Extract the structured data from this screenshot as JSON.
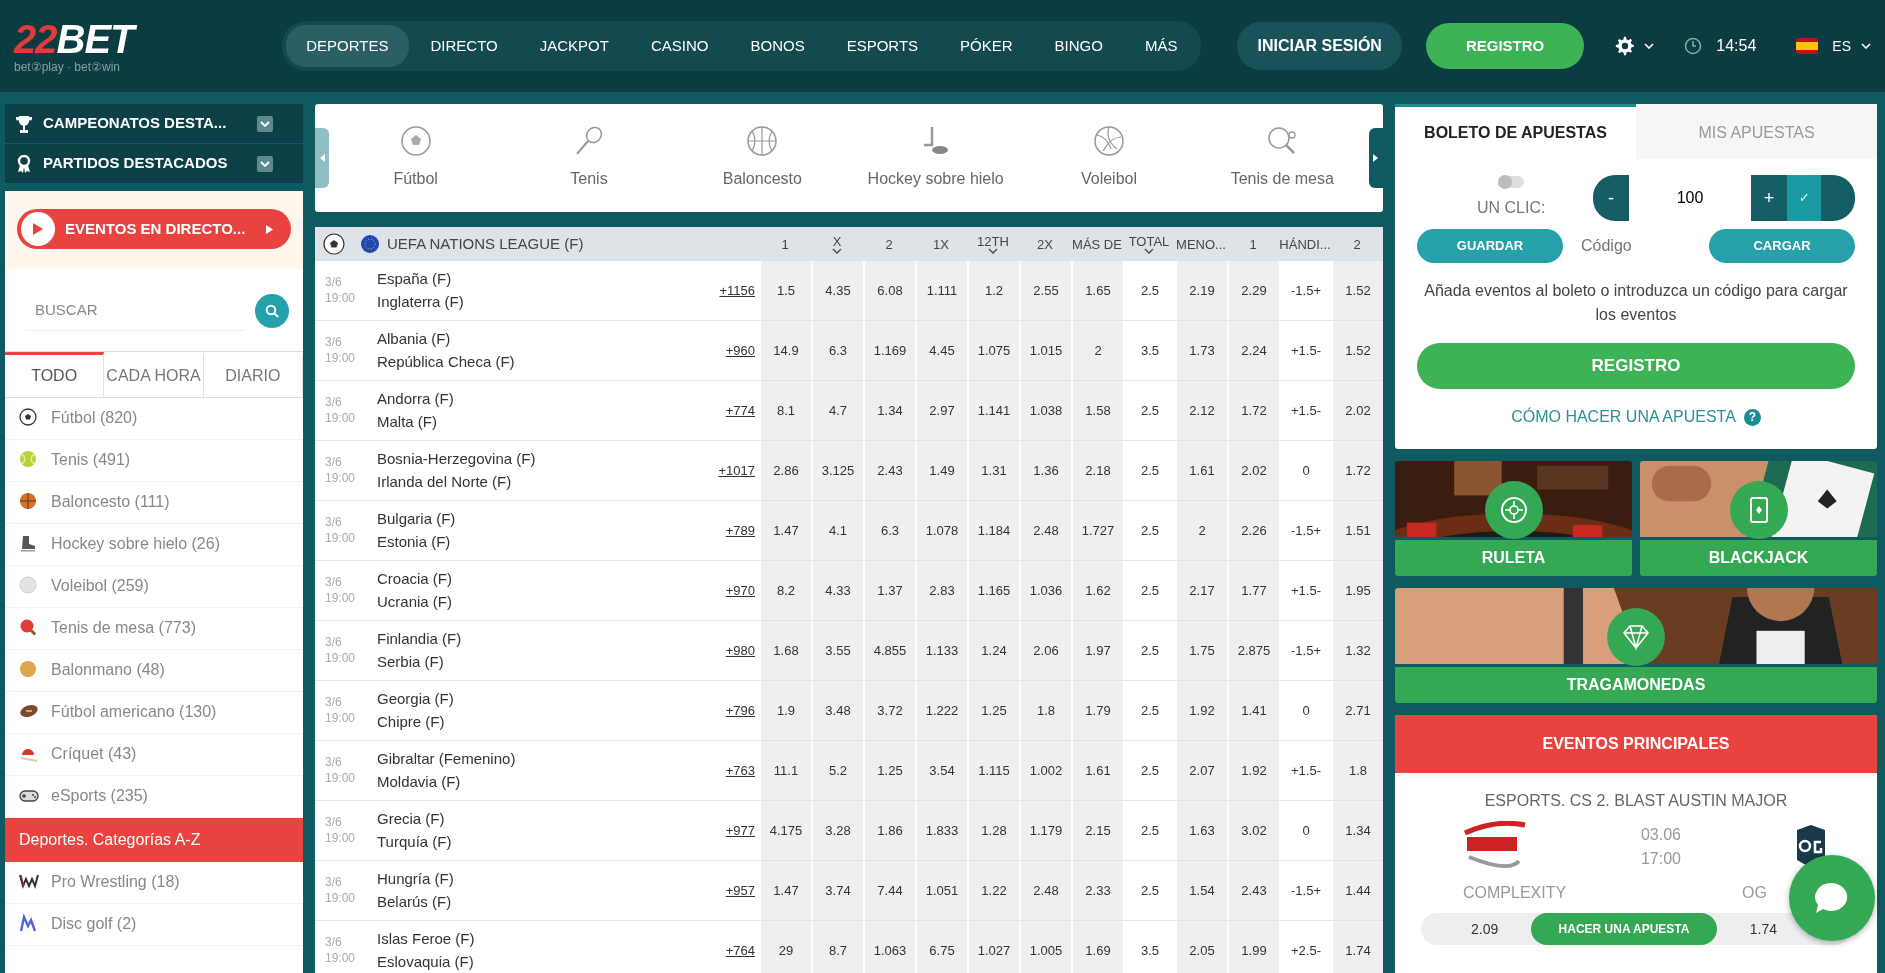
{
  "header": {
    "logo": {
      "mark": "22",
      "name": "BET",
      "tagline": "bet②play · bet②win"
    },
    "nav": [
      {
        "label": "DEPORTES",
        "selected": true
      },
      {
        "label": "DIRECTO",
        "selected": false
      },
      {
        "label": "JACKPOT",
        "selected": false
      },
      {
        "label": "CASINO",
        "selected": false
      },
      {
        "label": "BONOS",
        "selected": false
      },
      {
        "label": "ESPORTS",
        "selected": false
      },
      {
        "label": "PÓKER",
        "selected": false
      },
      {
        "label": "BINGO",
        "selected": false
      },
      {
        "label": "MÁS",
        "selected": false
      }
    ],
    "login": "INICIAR SESIÓN",
    "register": "REGISTRO",
    "time": "14:54",
    "language": "ES"
  },
  "sidebar": {
    "menus": [
      {
        "label": "CAMPEONATOS DESTA..."
      },
      {
        "label": "PARTIDOS DESTACADOS"
      }
    ],
    "live_button": "EVENTOS EN DIRECTO...",
    "search": {
      "placeholder": "BUSCAR"
    },
    "tabs": [
      {
        "label": "TODO",
        "selected": true
      },
      {
        "label": "CADA HORA",
        "selected": false
      },
      {
        "label": "DIARIO",
        "selected": false
      }
    ],
    "sports": [
      {
        "name": "Fútbol (820)"
      },
      {
        "name": "Tenis (491)"
      },
      {
        "name": "Baloncesto (111)"
      },
      {
        "name": "Hockey sobre hielo (26)"
      },
      {
        "name": "Voleibol (259)"
      },
      {
        "name": "Tenis de mesa (773)"
      },
      {
        "name": "Balonmano (48)"
      },
      {
        "name": "Fútbol americano (130)"
      },
      {
        "name": "Críquet (43)"
      },
      {
        "name": "eSports (235)"
      }
    ],
    "section": "Deportes. Categorías A-Z",
    "categories": [
      {
        "name": "Pro Wrestling (18)"
      },
      {
        "name": "Disc golf (2)"
      }
    ]
  },
  "sport_strip": {
    "items": [
      {
        "label": "Fútbol"
      },
      {
        "label": "Tenis"
      },
      {
        "label": "Baloncesto"
      },
      {
        "label": "Hockey sobre hielo"
      },
      {
        "label": "Voleibol"
      },
      {
        "label": "Tenis de mesa"
      }
    ]
  },
  "table": {
    "league": "UEFA NATIONS LEAGUE (F)",
    "columns": [
      {
        "label": "1",
        "kind": "odds",
        "dropdown": false
      },
      {
        "label": "X",
        "kind": "odds",
        "dropdown": true
      },
      {
        "label": "2",
        "kind": "odds",
        "dropdown": false
      },
      {
        "label": "1X",
        "kind": "odds",
        "dropdown": false
      },
      {
        "label": "12TH",
        "kind": "odds",
        "dropdown": true
      },
      {
        "label": "2X",
        "kind": "odds",
        "dropdown": false
      },
      {
        "label": "MÁS DE",
        "kind": "odds",
        "dropdown": false
      },
      {
        "label": "TOTAL",
        "kind": "param",
        "dropdown": true
      },
      {
        "label": "MENO...",
        "kind": "odds",
        "dropdown": false
      },
      {
        "label": "1",
        "kind": "odds",
        "dropdown": false
      },
      {
        "label": "HÁNDI...",
        "kind": "param",
        "dropdown": false
      },
      {
        "label": "2",
        "kind": "odds",
        "dropdown": false
      }
    ],
    "rows": [
      {
        "date": "3/6",
        "time": "19:00",
        "home": "España (F)",
        "away": "Inglaterra (F)",
        "more": "+1156",
        "odds": [
          "1.5",
          "4.35",
          "6.08",
          "1.111",
          "1.2",
          "2.55",
          "1.65",
          "2.5",
          "2.19",
          "2.29",
          "-1.5+",
          "1.52"
        ]
      },
      {
        "date": "3/6",
        "time": "19:00",
        "home": "Albania (F)",
        "away": "República Checa (F)",
        "more": "+960",
        "odds": [
          "14.9",
          "6.3",
          "1.169",
          "4.45",
          "1.075",
          "1.015",
          "2",
          "3.5",
          "1.73",
          "2.24",
          "+1.5-",
          "1.52"
        ]
      },
      {
        "date": "3/6",
        "time": "19:00",
        "home": "Andorra (F)",
        "away": "Malta (F)",
        "more": "+774",
        "odds": [
          "8.1",
          "4.7",
          "1.34",
          "2.97",
          "1.141",
          "1.038",
          "1.58",
          "2.5",
          "2.12",
          "1.72",
          "+1.5-",
          "2.02"
        ]
      },
      {
        "date": "3/6",
        "time": "19:00",
        "home": "Bosnia-Herzegovina (F)",
        "away": "Irlanda del Norte (F)",
        "more": "+1017",
        "odds": [
          "2.86",
          "3.125",
          "2.43",
          "1.49",
          "1.31",
          "1.36",
          "2.18",
          "2.5",
          "1.61",
          "2.02",
          "0",
          "1.72"
        ]
      },
      {
        "date": "3/6",
        "time": "19:00",
        "home": "Bulgaria (F)",
        "away": "Estonia (F)",
        "more": "+789",
        "odds": [
          "1.47",
          "4.1",
          "6.3",
          "1.078",
          "1.184",
          "2.48",
          "1.727",
          "2.5",
          "2",
          "2.26",
          "-1.5+",
          "1.51"
        ]
      },
      {
        "date": "3/6",
        "time": "19:00",
        "home": "Croacia (F)",
        "away": "Ucrania (F)",
        "more": "+970",
        "odds": [
          "8.2",
          "4.33",
          "1.37",
          "2.83",
          "1.165",
          "1.036",
          "1.62",
          "2.5",
          "2.17",
          "1.77",
          "+1.5-",
          "1.95"
        ]
      },
      {
        "date": "3/6",
        "time": "19:00",
        "home": "Finlandia (F)",
        "away": "Serbia (F)",
        "more": "+980",
        "odds": [
          "1.68",
          "3.55",
          "4.855",
          "1.133",
          "1.24",
          "2.06",
          "1.97",
          "2.5",
          "1.75",
          "2.875",
          "-1.5+",
          "1.32"
        ]
      },
      {
        "date": "3/6",
        "time": "19:00",
        "home": "Georgia (F)",
        "away": "Chipre (F)",
        "more": "+796",
        "odds": [
          "1.9",
          "3.48",
          "3.72",
          "1.222",
          "1.25",
          "1.8",
          "1.79",
          "2.5",
          "1.92",
          "1.41",
          "0",
          "2.71"
        ]
      },
      {
        "date": "3/6",
        "time": "19:00",
        "home": "Gibraltar (Femenino)",
        "away": "Moldavia (F)",
        "more": "+763",
        "odds": [
          "11.1",
          "5.2",
          "1.25",
          "3.54",
          "1.115",
          "1.002",
          "1.61",
          "2.5",
          "2.07",
          "1.92",
          "+1.5-",
          "1.8"
        ]
      },
      {
        "date": "3/6",
        "time": "19:00",
        "home": "Grecia (F)",
        "away": "Turquía (F)",
        "more": "+977",
        "odds": [
          "4.175",
          "3.28",
          "1.86",
          "1.833",
          "1.28",
          "1.179",
          "2.15",
          "2.5",
          "1.63",
          "3.02",
          "0",
          "1.34"
        ]
      },
      {
        "date": "3/6",
        "time": "19:00",
        "home": "Hungría (F)",
        "away": "Belarús (F)",
        "more": "+957",
        "odds": [
          "1.47",
          "3.74",
          "7.44",
          "1.051",
          "1.22",
          "2.48",
          "2.33",
          "2.5",
          "1.54",
          "2.43",
          "-1.5+",
          "1.44"
        ]
      },
      {
        "date": "3/6",
        "time": "19:00",
        "home": "Islas Feroe (F)",
        "away": "Eslovaquia (F)",
        "more": "+764",
        "odds": [
          "29",
          "8.7",
          "1.063",
          "6.75",
          "1.027",
          "1.005",
          "1.69",
          "3.5",
          "2.05",
          "1.99",
          "+2.5-",
          "1.74"
        ]
      }
    ]
  },
  "betslip": {
    "tabs": [
      {
        "label": "BOLETO DE APUESTAS",
        "selected": true
      },
      {
        "label": "MIS APUESTAS",
        "selected": false
      }
    ],
    "one_click": {
      "label": "UN CLIC:",
      "on": false
    },
    "stake": {
      "minus": "-",
      "value": "100",
      "plus": "+",
      "confirm": "✓"
    },
    "save": "GUARDAR",
    "code": {
      "placeholder": "Código"
    },
    "load": "CARGAR",
    "message": "Añada eventos al boleto o introduzca un código para cargar los eventos",
    "register": "REGISTRO",
    "help": "CÓMO HACER UNA APUESTA",
    "help_mark": "?"
  },
  "casino": [
    {
      "label": "RULETA"
    },
    {
      "label": "BLACKJACK"
    },
    {
      "label": "TRAGAMONEDAS"
    }
  ],
  "top_events": {
    "title": "EVENTOS PRINCIPALES",
    "event": "ESPORTS. CS 2. BLAST AUSTIN MAJOR",
    "date": "03.06",
    "time": "17:00",
    "home": "COMPLEXITY",
    "away": "OG",
    "home_odds": "2.09",
    "bet": "HACER UNA APUESTA",
    "away_odds": "1.74"
  }
}
